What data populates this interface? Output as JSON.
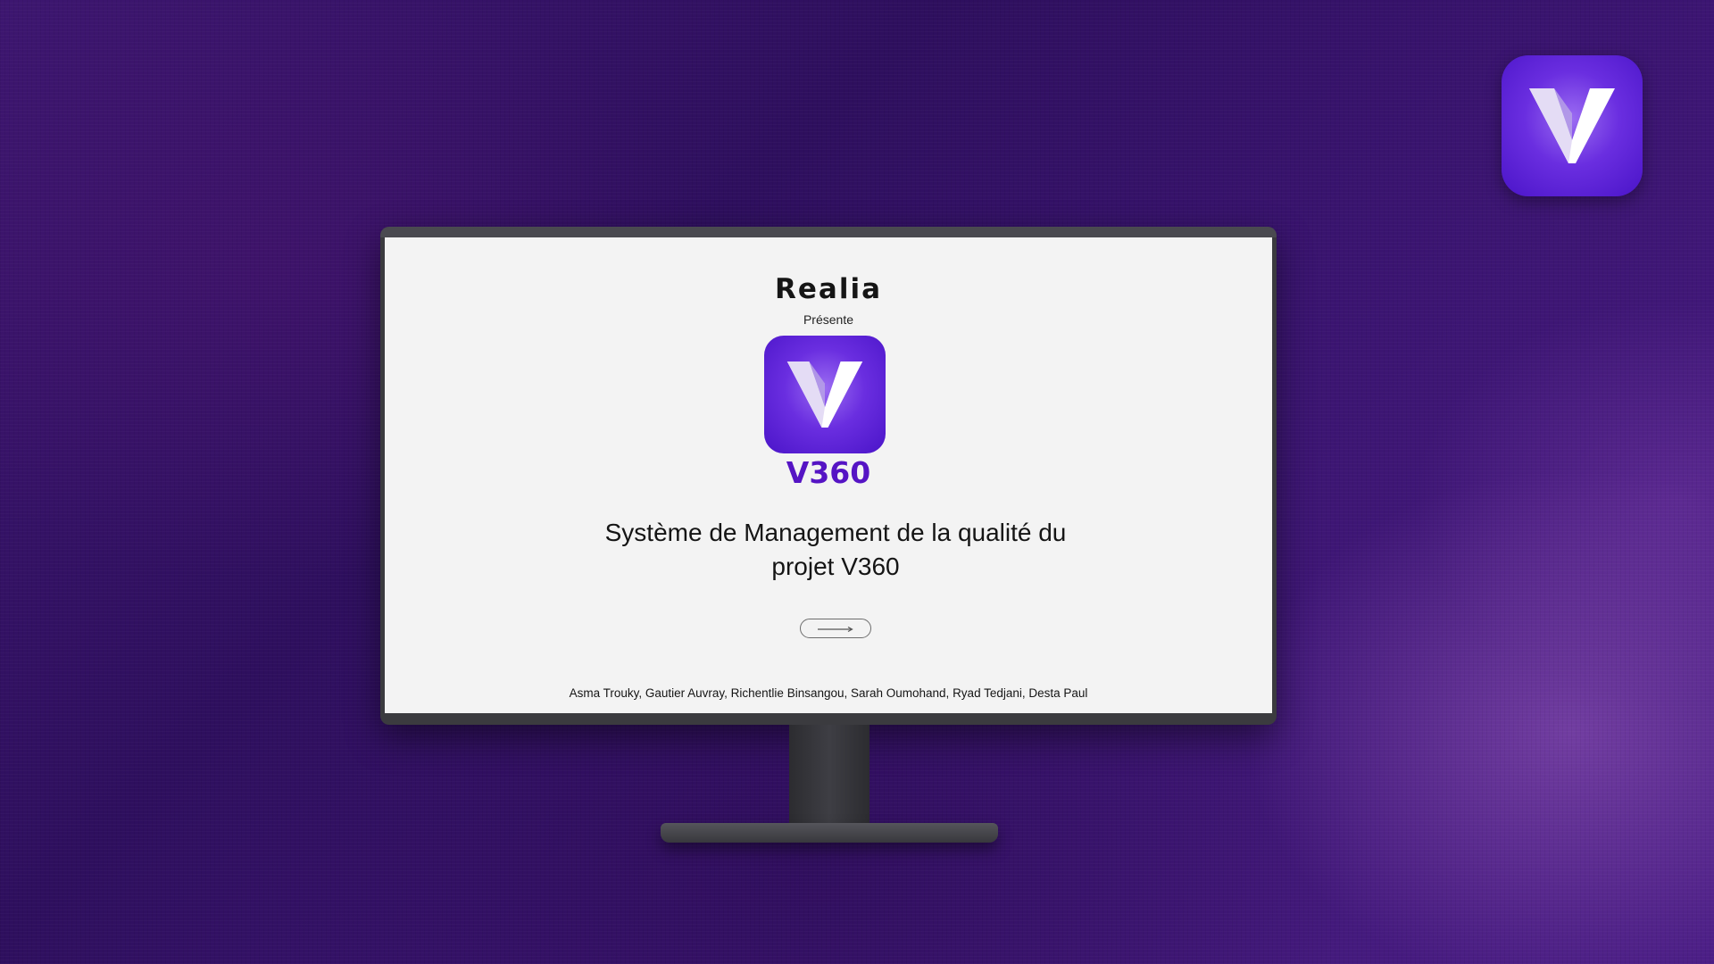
{
  "header": {
    "brand": "Realia",
    "presents": "Présente"
  },
  "app": {
    "icon": "v-logo-icon",
    "name": "V360"
  },
  "slide": {
    "title_line1": "Système de Management de la qualité du",
    "title_line2": "projet V360",
    "next_button_icon": "arrow-right-icon",
    "authors": "Asma Trouky, Gautier Auvray, Richentlie Binsangou, Sarah Oumohand, Ryad Tedjani, Desta Paul"
  },
  "colors": {
    "background": "#3a1470",
    "icon_purple": "#6a2ee0",
    "app_name": "#5514c4",
    "screen": "#f3f3f3"
  }
}
